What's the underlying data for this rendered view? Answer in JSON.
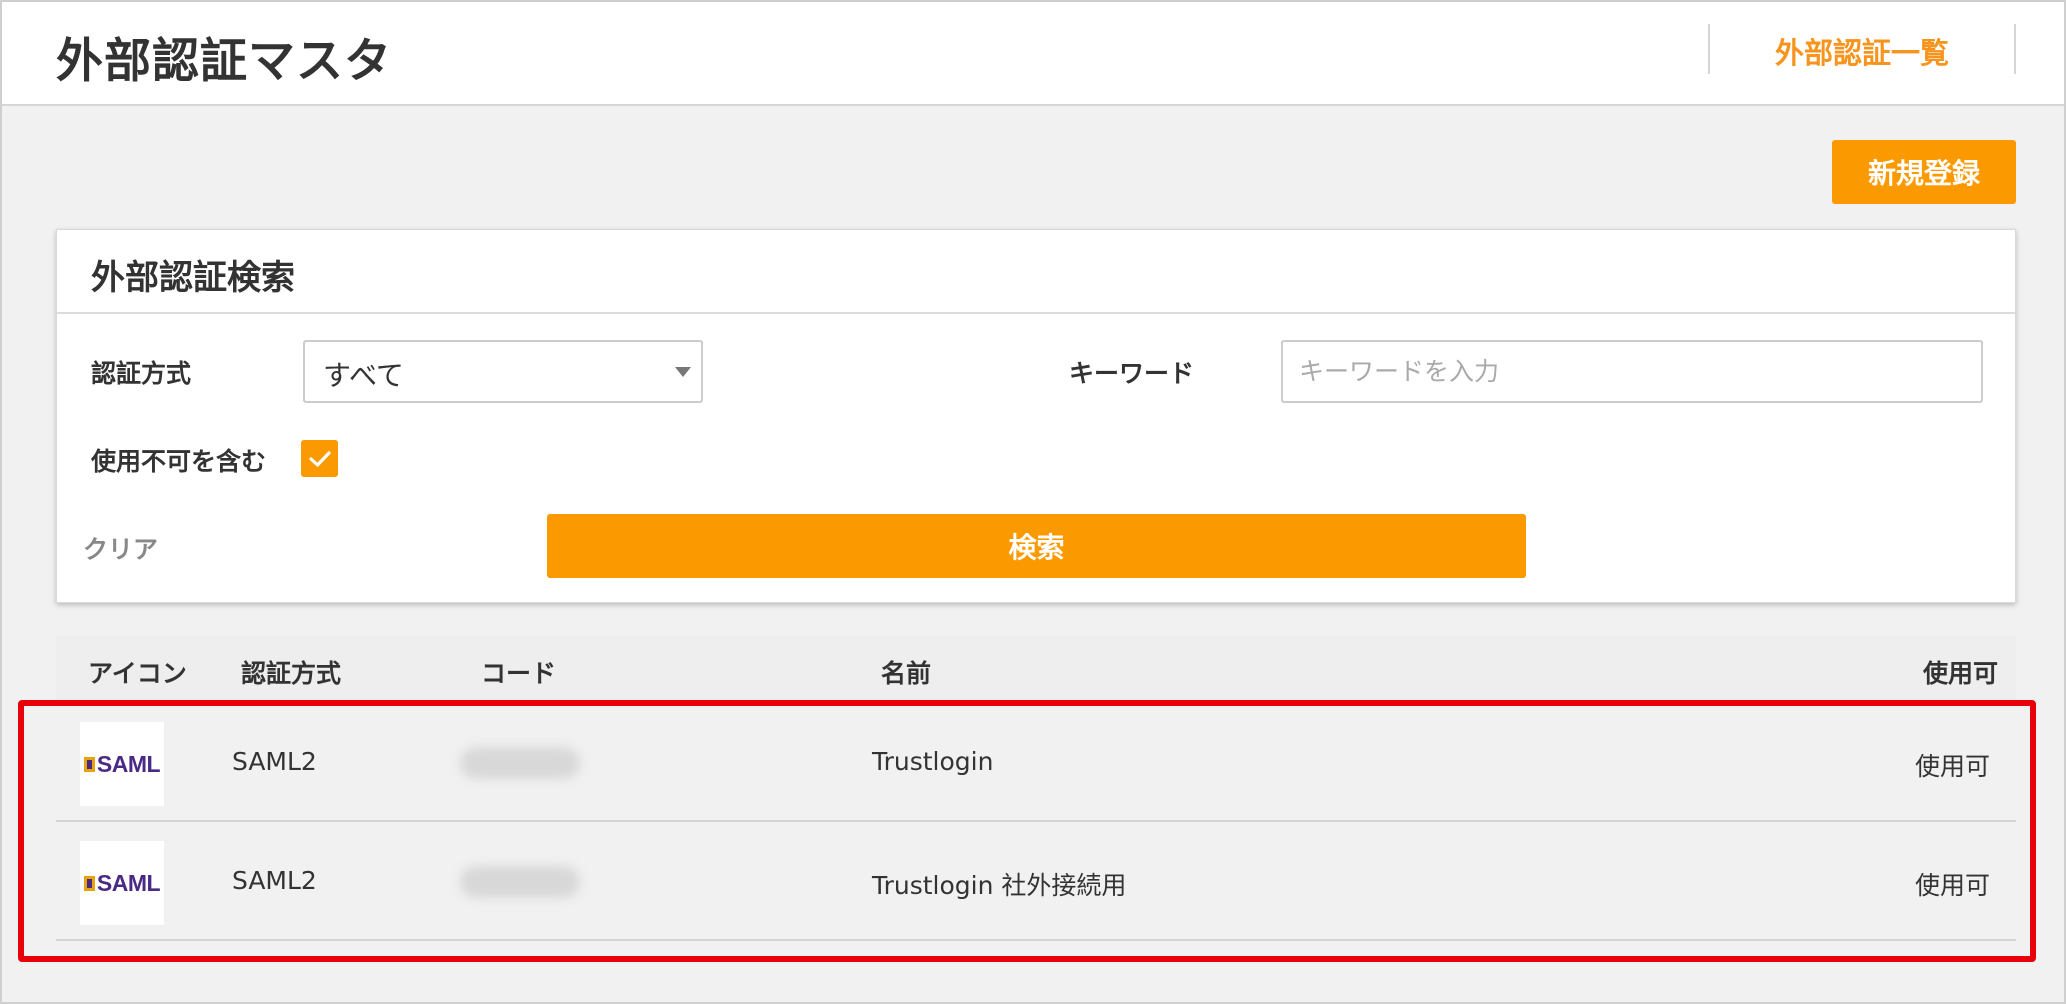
{
  "header": {
    "title": "外部認証マスタ",
    "link_label": "外部認証一覧"
  },
  "toolbar": {
    "new_label": "新規登録"
  },
  "search": {
    "title": "外部認証検索",
    "auth_method_label": "認証方式",
    "auth_method_value": "すべて",
    "keyword_label": "キーワード",
    "keyword_value": "",
    "keyword_placeholder": "キーワードを入力",
    "include_disabled_label": "使用不可を含む",
    "include_disabled_checked": true,
    "clear_label": "クリア",
    "search_label": "検索"
  },
  "table": {
    "columns": {
      "icon": "アイコン",
      "auth_method": "認証方式",
      "code": "コード",
      "name": "名前",
      "usable": "使用可"
    },
    "rows": [
      {
        "icon": "saml-logo-icon",
        "logo_text": "SAML",
        "auth_method": "SAML2",
        "code": "",
        "name": "Trustlogin",
        "usable": "使用可"
      },
      {
        "icon": "saml-logo-icon",
        "logo_text": "SAML",
        "auth_method": "SAML2",
        "code": "",
        "name": "Trustlogin 社外接続用",
        "usable": "使用可"
      }
    ]
  },
  "colors": {
    "accent": "#fb9900",
    "link": "#f7941d",
    "highlight": "#e8000b",
    "background": "#f1f1f1"
  }
}
